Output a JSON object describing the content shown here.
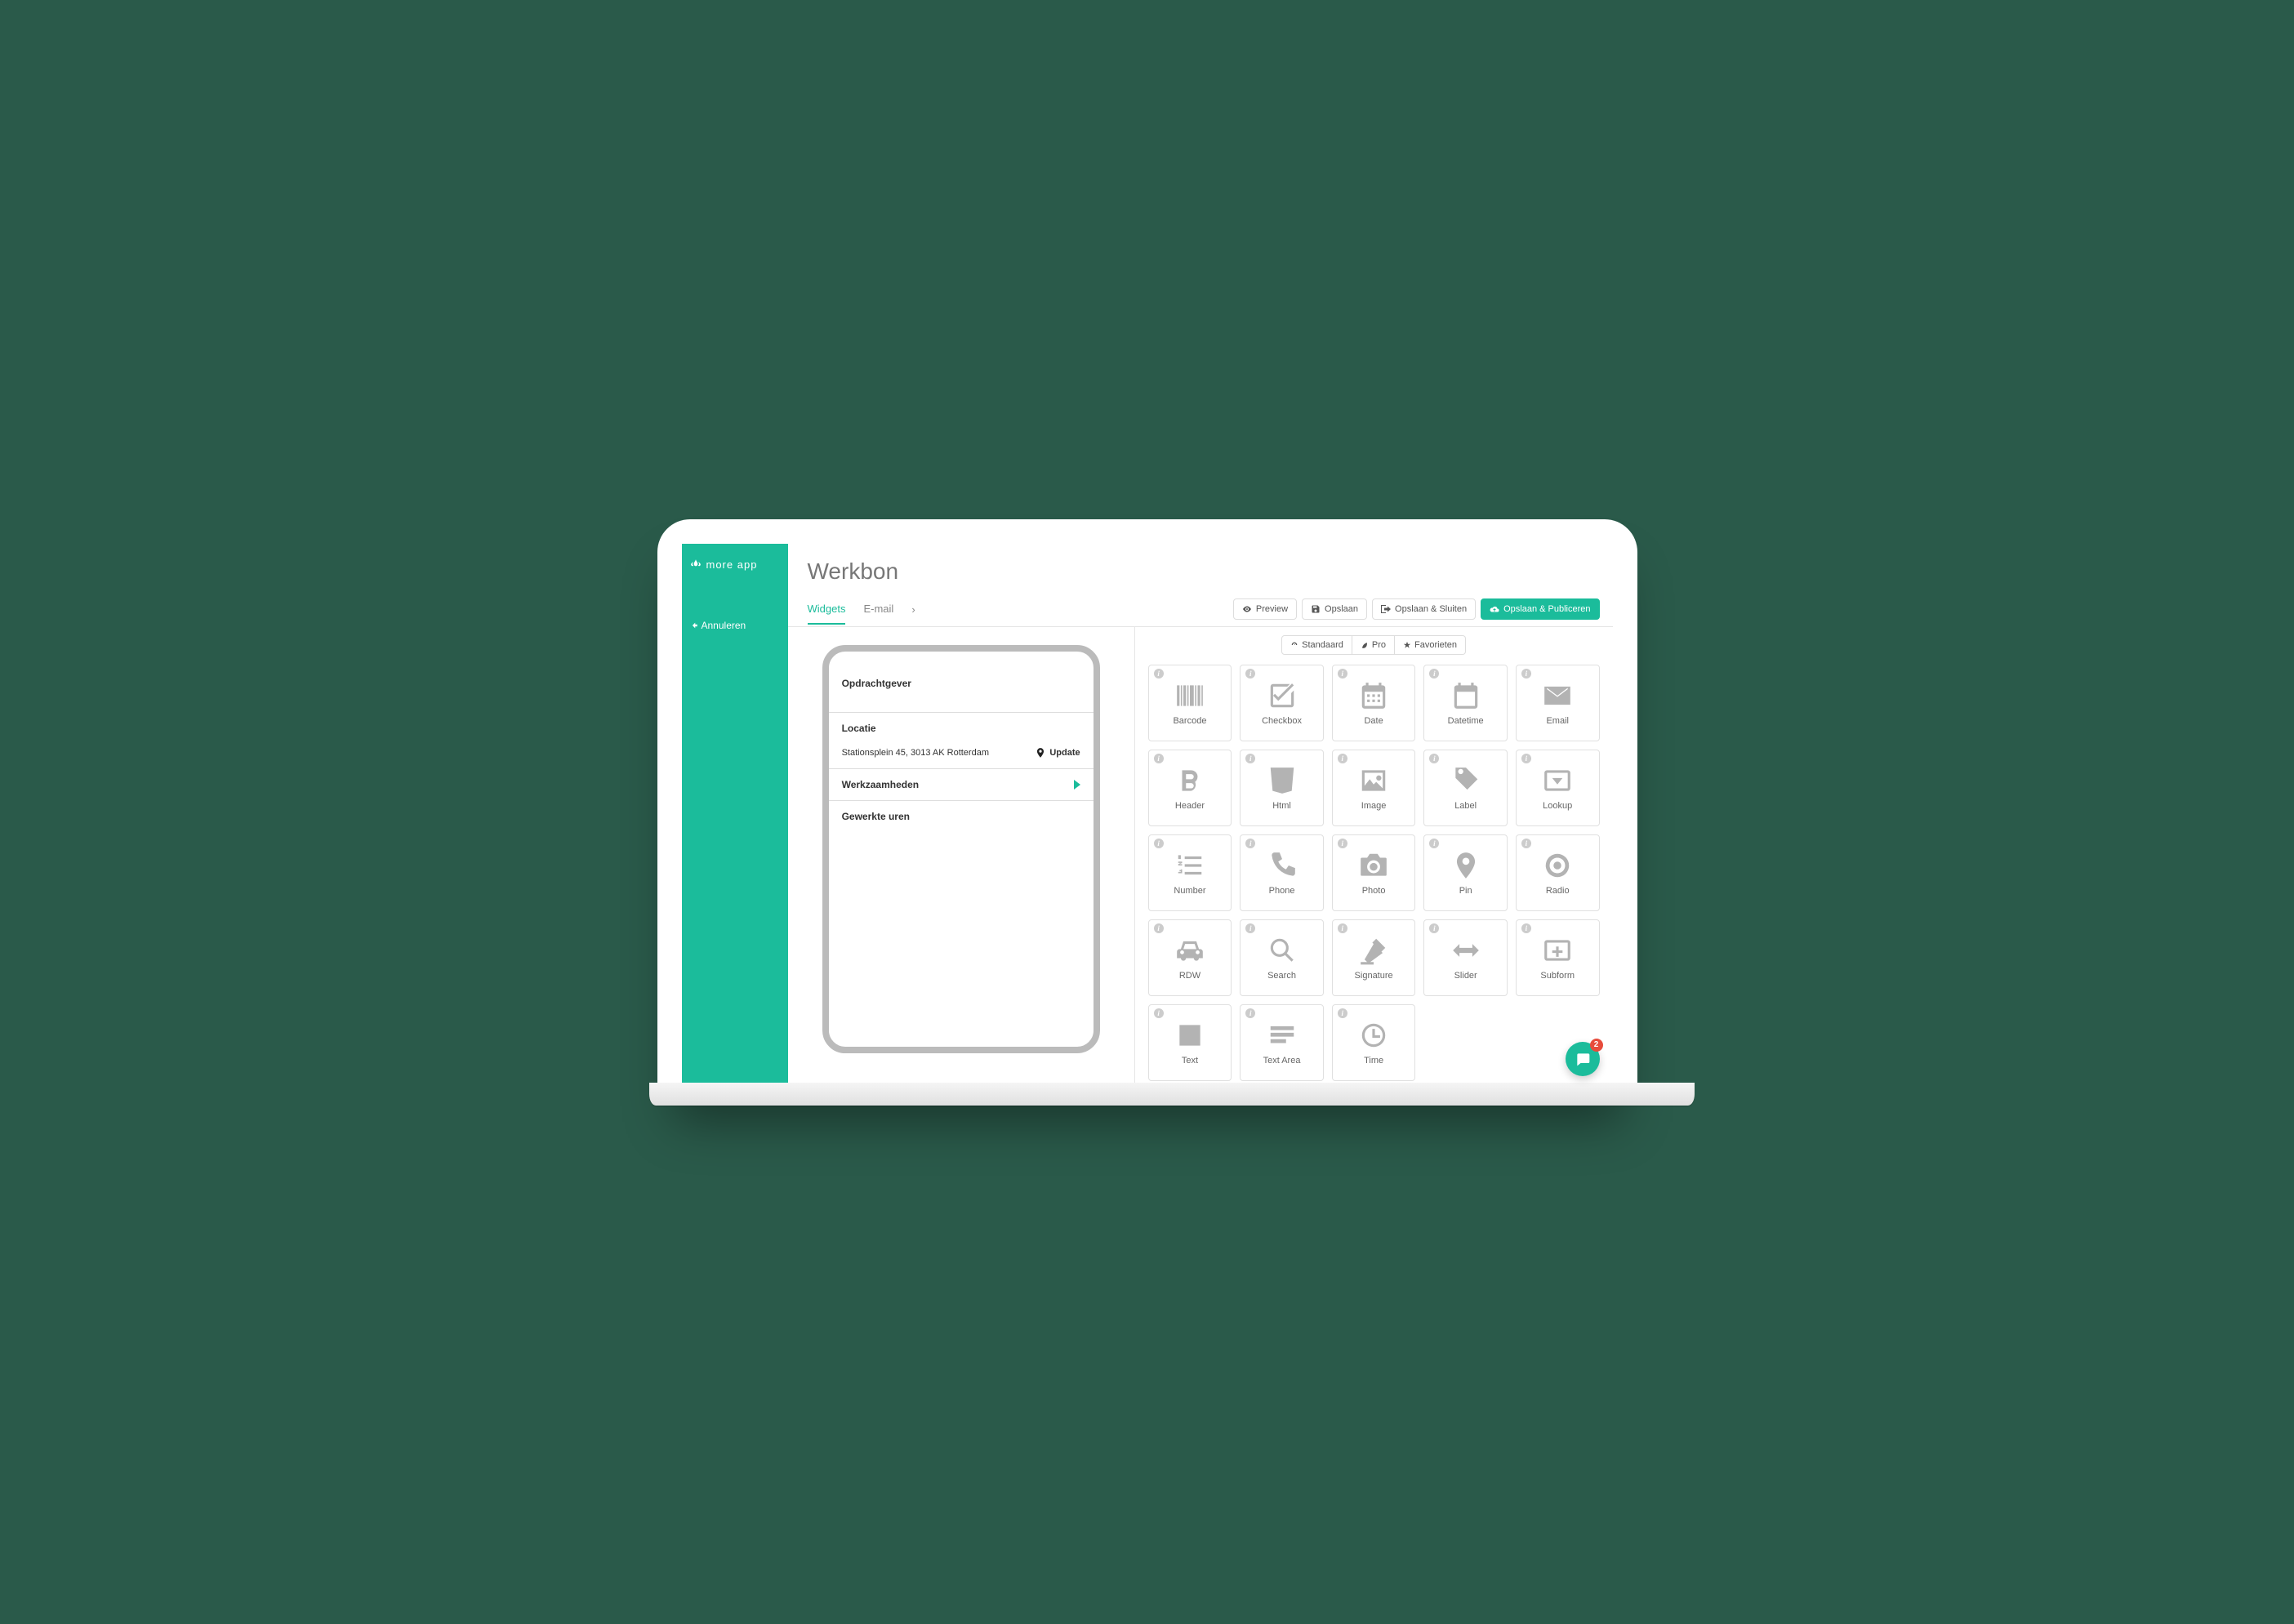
{
  "brand": "more app",
  "cancel_label": "Annuleren",
  "page_title": "Werkbon",
  "tabs": {
    "widgets": "Widgets",
    "email": "E-mail"
  },
  "toolbar": {
    "preview": "Preview",
    "save": "Opslaan",
    "save_close": "Opslaan & Sluiten",
    "save_publish": "Opslaan & Publiceren"
  },
  "form": {
    "opdrachtgever": "Opdrachtgever",
    "locatie": "Locatie",
    "locatie_value": "Stationsplein 45, 3013 AK Rotterdam",
    "update": "Update",
    "werkzaamheden": "Werkzaamheden",
    "gewerkte_uren": "Gewerkte uren"
  },
  "pill_tabs": {
    "standaard": "Standaard",
    "pro": "Pro",
    "favorieten": "Favorieten"
  },
  "widgets": {
    "barcode": "Barcode",
    "checkbox": "Checkbox",
    "date": "Date",
    "datetime": "Datetime",
    "email": "Email",
    "header": "Header",
    "html": "Html",
    "image": "Image",
    "label": "Label",
    "lookup": "Lookup",
    "number": "Number",
    "phone": "Phone",
    "photo": "Photo",
    "pin": "Pin",
    "radio": "Radio",
    "rdw": "RDW",
    "search": "Search",
    "signature": "Signature",
    "slider": "Slider",
    "subform": "Subform",
    "text": "Text",
    "textarea": "Text Area",
    "time": "Time"
  },
  "chat_badge": "2"
}
